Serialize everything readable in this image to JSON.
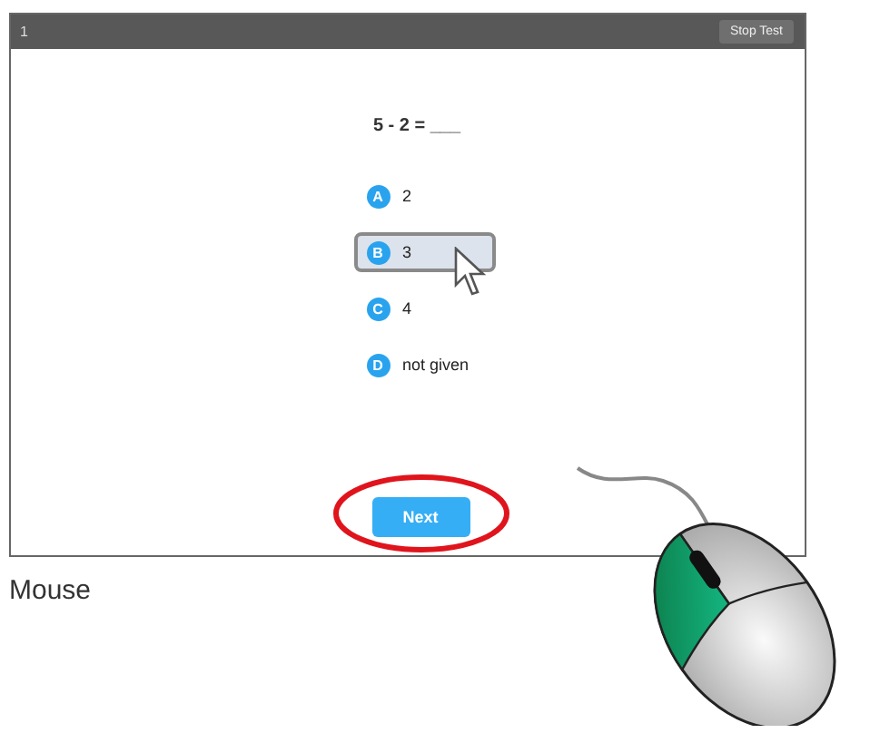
{
  "header": {
    "question_number": "1",
    "stop_button": "Stop Test"
  },
  "question": "5 - 2 = ___",
  "options": [
    {
      "letter": "A",
      "text": "2",
      "selected": false
    },
    {
      "letter": "B",
      "text": "3",
      "selected": true
    },
    {
      "letter": "C",
      "text": "4",
      "selected": false
    },
    {
      "letter": "D",
      "text": "not given",
      "selected": false
    }
  ],
  "next_button": "Next",
  "caption": "Mouse"
}
